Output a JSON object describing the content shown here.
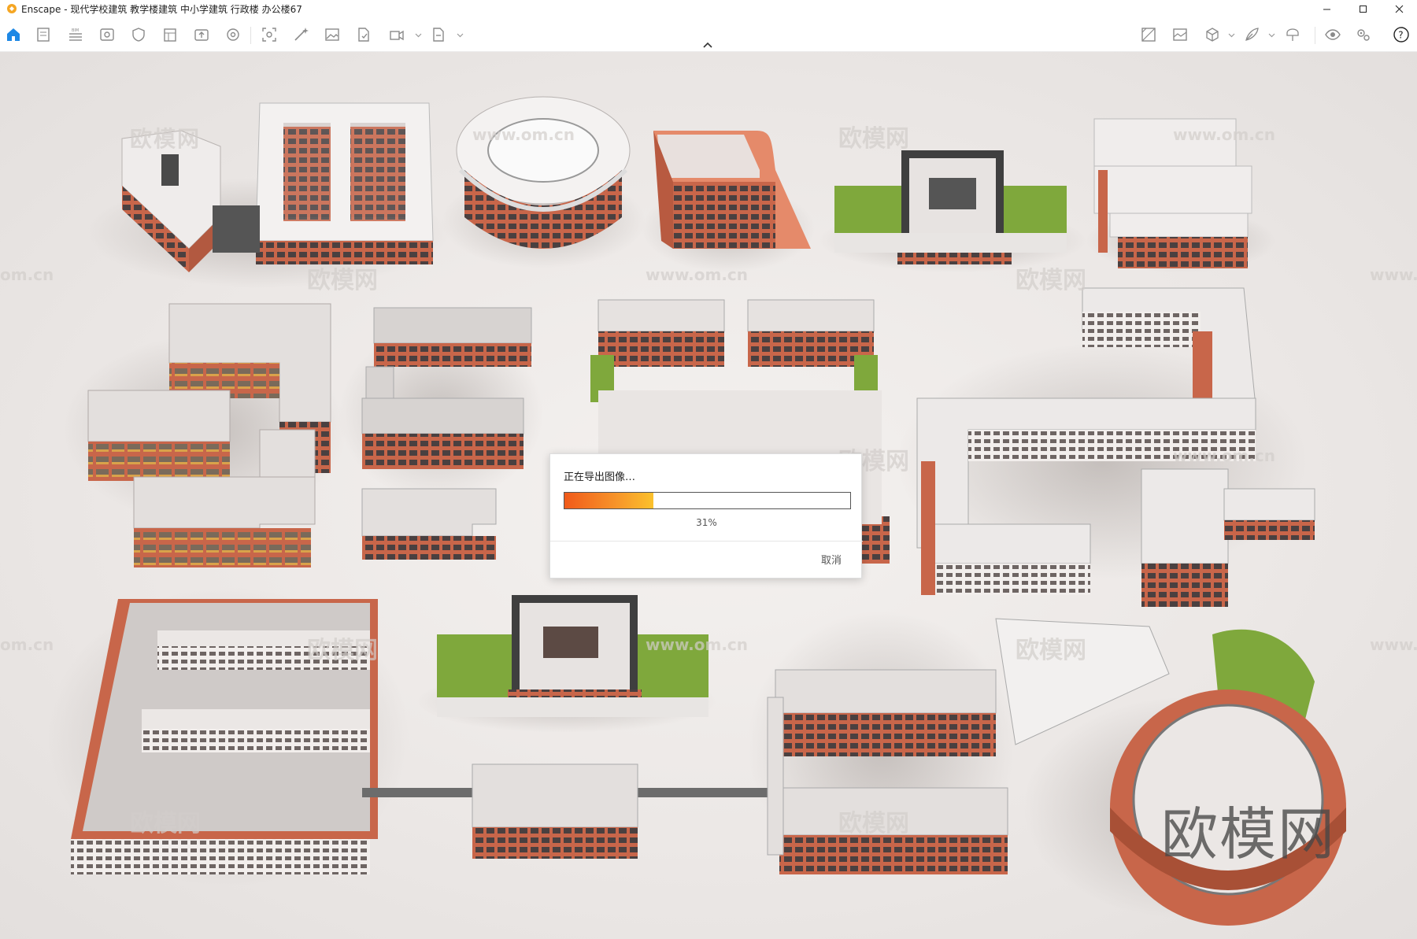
{
  "window": {
    "title": "Enscape - 现代学校建筑 教学楼建筑 中小学建筑 行政楼 办公楼67",
    "controls": [
      "minimize",
      "maximize",
      "close"
    ]
  },
  "toolbar": {
    "left_icons": [
      "home-icon",
      "document-icon",
      "bim-icon",
      "view-icon",
      "shield-icon",
      "library-icon",
      "upload-icon",
      "settings-wheel-icon",
      "screenshot-icon",
      "magic-icon",
      "image-icon",
      "file-export-icon",
      "video-icon",
      "export-icon"
    ],
    "right_icons": [
      "map-icon",
      "panorama-icon",
      "cube-icon",
      "feather-icon",
      "vr-icon",
      "eye-icon",
      "gears-icon",
      "help-icon"
    ],
    "collapse_icon": "chevron-up-icon"
  },
  "viewport": {
    "watermark_cn": "欧模网",
    "watermark_url": "www.om.cn",
    "watermark_url_short": "om.cn",
    "watermark_url_partial": "www.",
    "big_watermark": "欧模网"
  },
  "dialog": {
    "title": "正在导出图像…",
    "progress_percent": 31,
    "progress_label": "31%",
    "cancel_label": "取消"
  },
  "colors": {
    "accent": "#1e88e5",
    "brick": "#c8664a",
    "progress_start": "#f05a1a",
    "progress_end": "#fbc12c",
    "grass": "#7fa83c"
  }
}
